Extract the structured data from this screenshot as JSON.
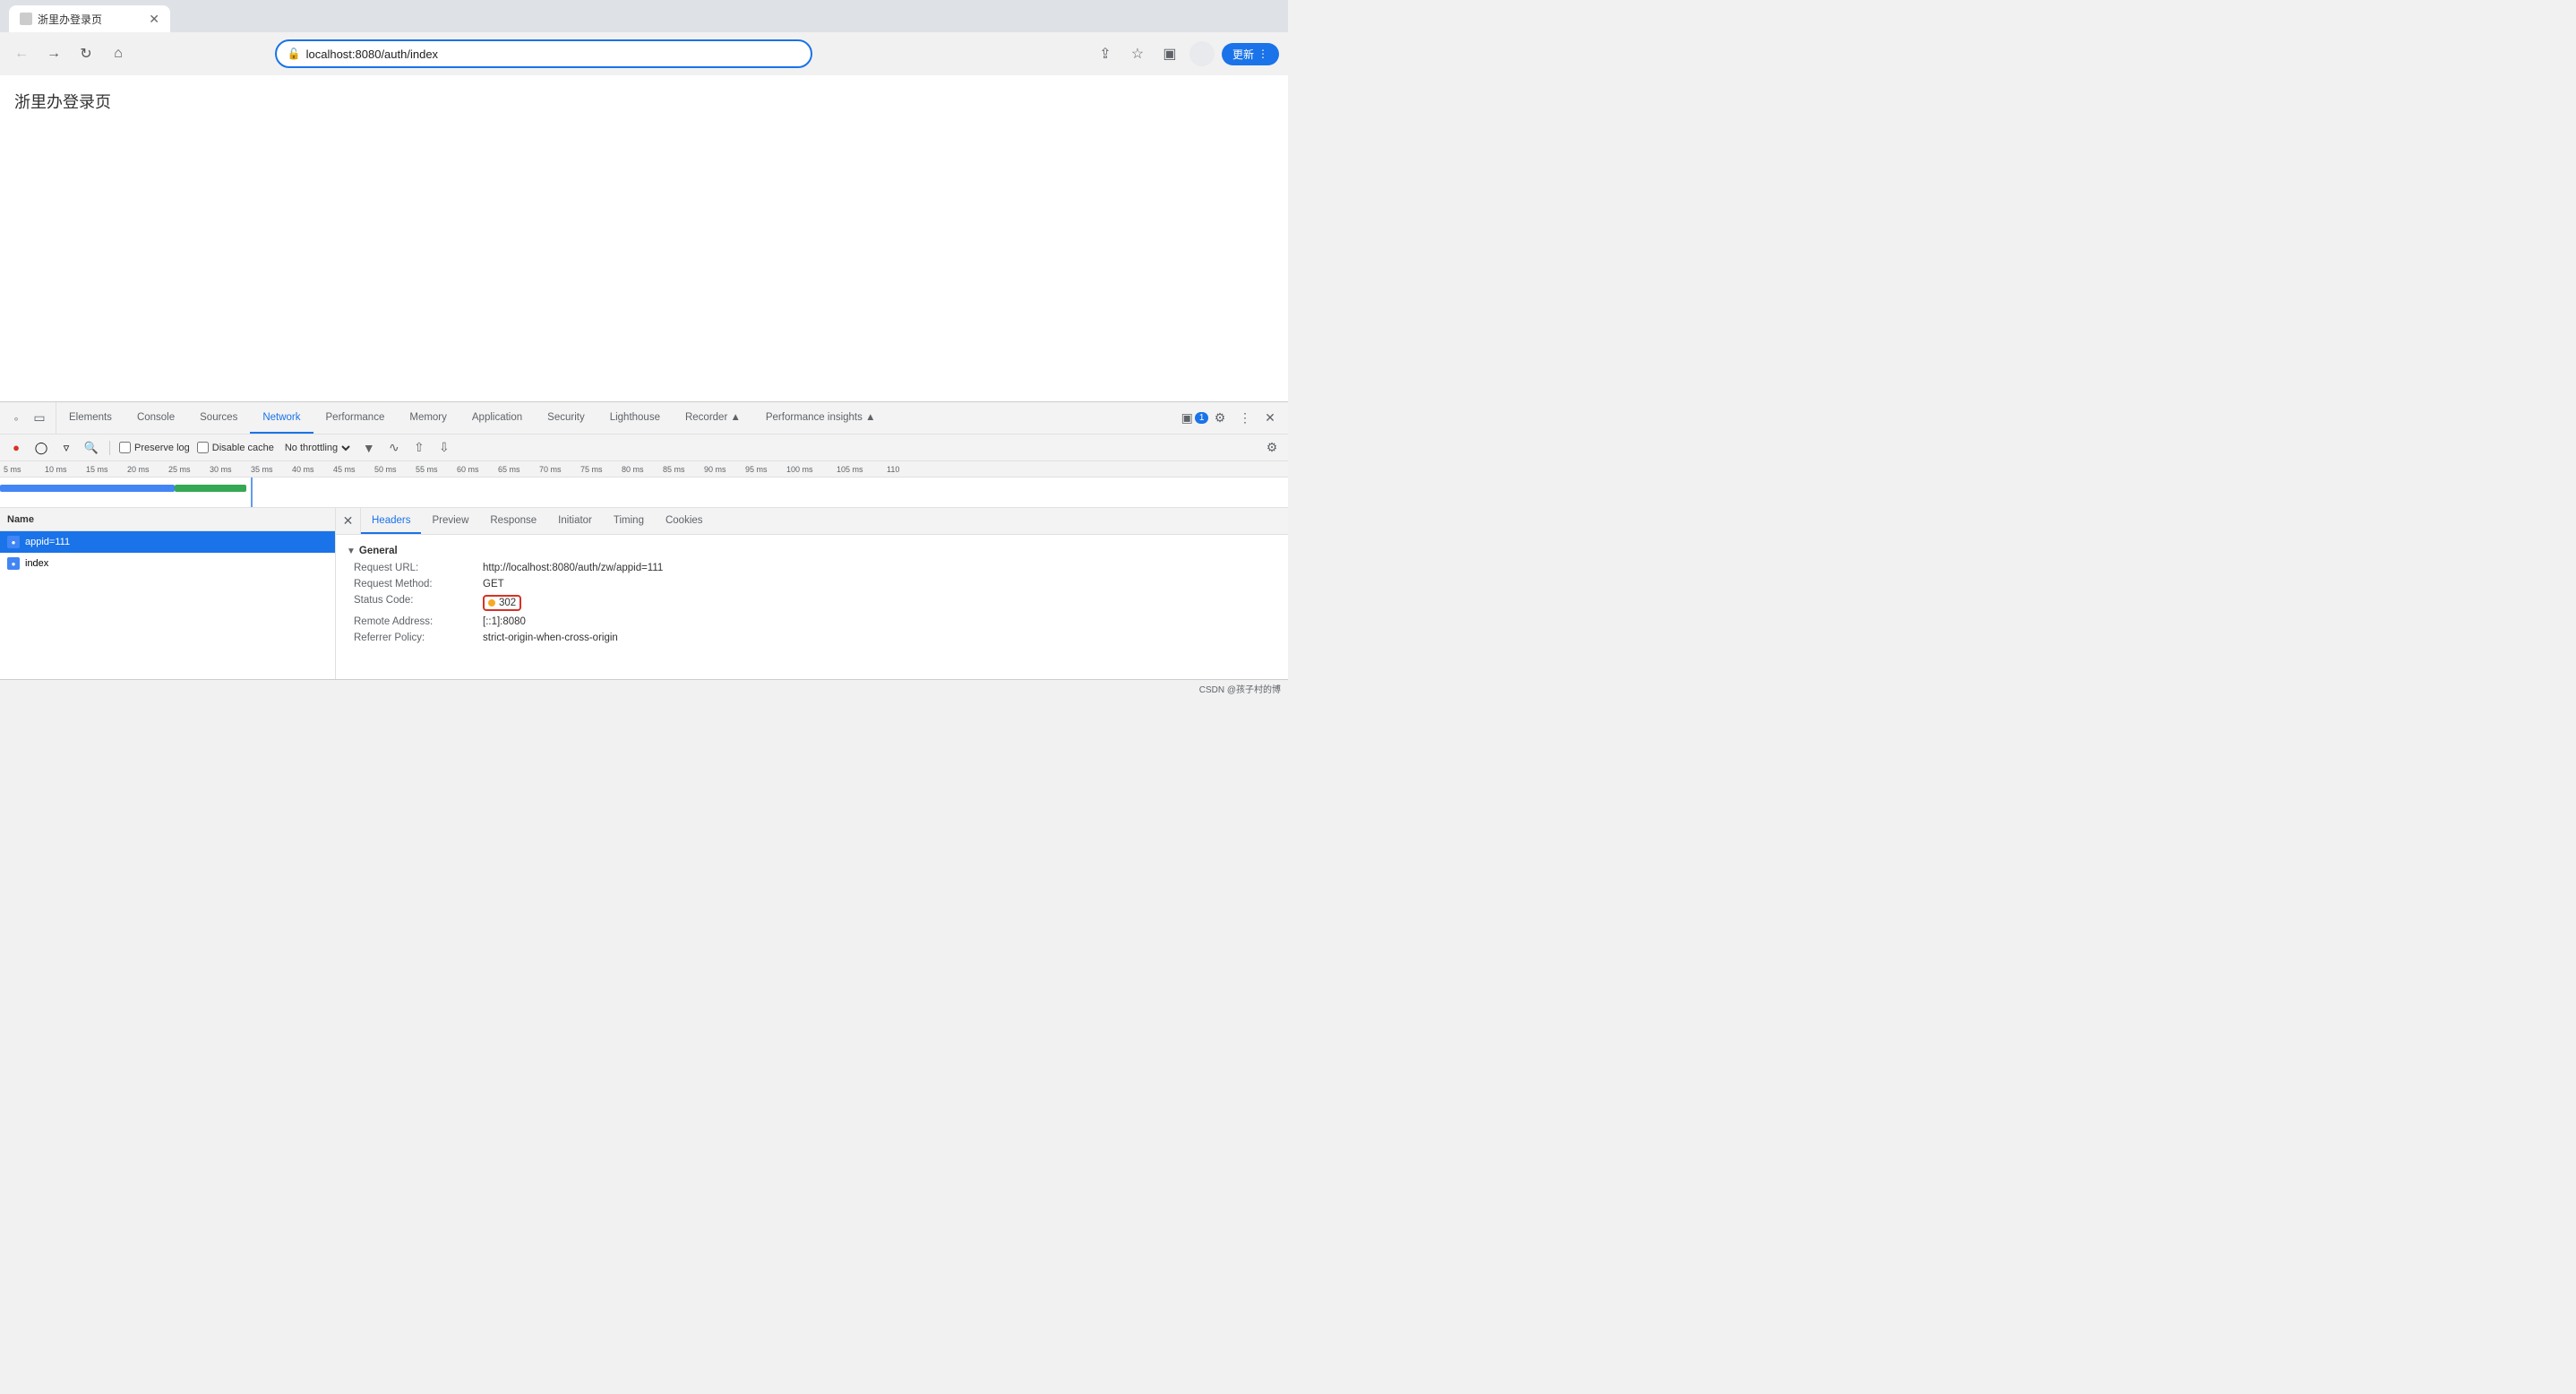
{
  "browser": {
    "tab_title": "浙里办登录页",
    "address": "localhost:8080/auth/index",
    "update_btn": "更新",
    "favicon": ""
  },
  "webpage": {
    "content": "浙里办登录页"
  },
  "devtools": {
    "tabs": [
      {
        "label": "Elements",
        "active": false
      },
      {
        "label": "Console",
        "active": false
      },
      {
        "label": "Sources",
        "active": false
      },
      {
        "label": "Network",
        "active": true
      },
      {
        "label": "Performance",
        "active": false
      },
      {
        "label": "Memory",
        "active": false
      },
      {
        "label": "Application",
        "active": false
      },
      {
        "label": "Security",
        "active": false
      },
      {
        "label": "Lighthouse",
        "active": false
      },
      {
        "label": "Recorder ▲",
        "active": false
      },
      {
        "label": "Performance insights ▲",
        "active": false
      }
    ],
    "badge_count": "1",
    "toolbar": {
      "preserve_log": "Preserve log",
      "disable_cache": "Disable cache",
      "throttle": "No throttling"
    },
    "timeline_ticks": [
      "5 ms",
      "10 ms",
      "15 ms",
      "20 ms",
      "25 ms",
      "30 ms",
      "35 ms",
      "40 ms",
      "45 ms",
      "50 ms",
      "55 ms",
      "60 ms",
      "65 ms",
      "70 ms",
      "75 ms",
      "80 ms",
      "85 ms",
      "90 ms",
      "95 ms",
      "100 ms",
      "105 ms",
      "110"
    ],
    "requests": [
      {
        "name": "appid=111",
        "selected": true
      },
      {
        "name": "index",
        "selected": false
      }
    ],
    "name_col": "Name",
    "detail_tabs": [
      "Headers",
      "Preview",
      "Response",
      "Initiator",
      "Timing",
      "Cookies"
    ],
    "active_detail_tab": "Headers",
    "general_section": "General",
    "general_fields": [
      {
        "key": "Request URL:",
        "value": "http://localhost:8080/auth/zw/appid=111"
      },
      {
        "key": "Request Method:",
        "value": "GET"
      },
      {
        "key": "Status Code:",
        "value": "302",
        "highlighted": true
      },
      {
        "key": "Remote Address:",
        "value": "[::1]:8080"
      },
      {
        "key": "Referrer Policy:",
        "value": "strict-origin-when-cross-origin"
      }
    ]
  },
  "status_bar": {
    "watermark": "CSDN @孩子村的博"
  }
}
